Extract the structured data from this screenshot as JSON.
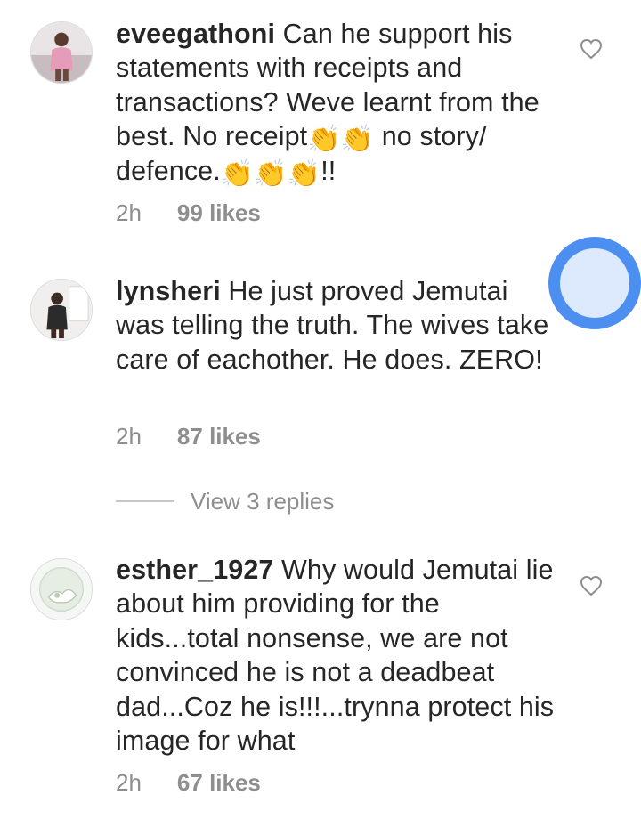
{
  "comments": [
    {
      "username": "eveegathoni",
      "text_before": "Can he support his statements with receipts and transactions? Weve learnt from the best. No receipt",
      "emoji_mid": "👏👏",
      "text_mid": " no story/ defence.",
      "emoji_end": "👏👏👏",
      "text_end": "!!",
      "time": "2h",
      "likes": "99 likes",
      "heart_icon": "heart-outline-icon"
    },
    {
      "username": "lynsheri",
      "text": "He just proved Jemutai was telling the truth. The wives take care of eachother. He does. ZERO!",
      "time": "2h",
      "likes": "87 likes"
    },
    {
      "username": "esther_1927",
      "text": "Why would Jemutai lie about him providing for the kids...total nonsense, we are not convinced he is not a deadbeat dad...Coz he is!!!...trynna protect his image for what",
      "time": "2h",
      "likes": "67 likes",
      "heart_icon": "heart-outline-icon"
    }
  ],
  "view_replies": "View 3 replies",
  "colors": {
    "text": "#262626",
    "secondary": "#8e8e8e",
    "touch_ring": "#4c8ff0",
    "touch_inner": "#dde9fc"
  }
}
